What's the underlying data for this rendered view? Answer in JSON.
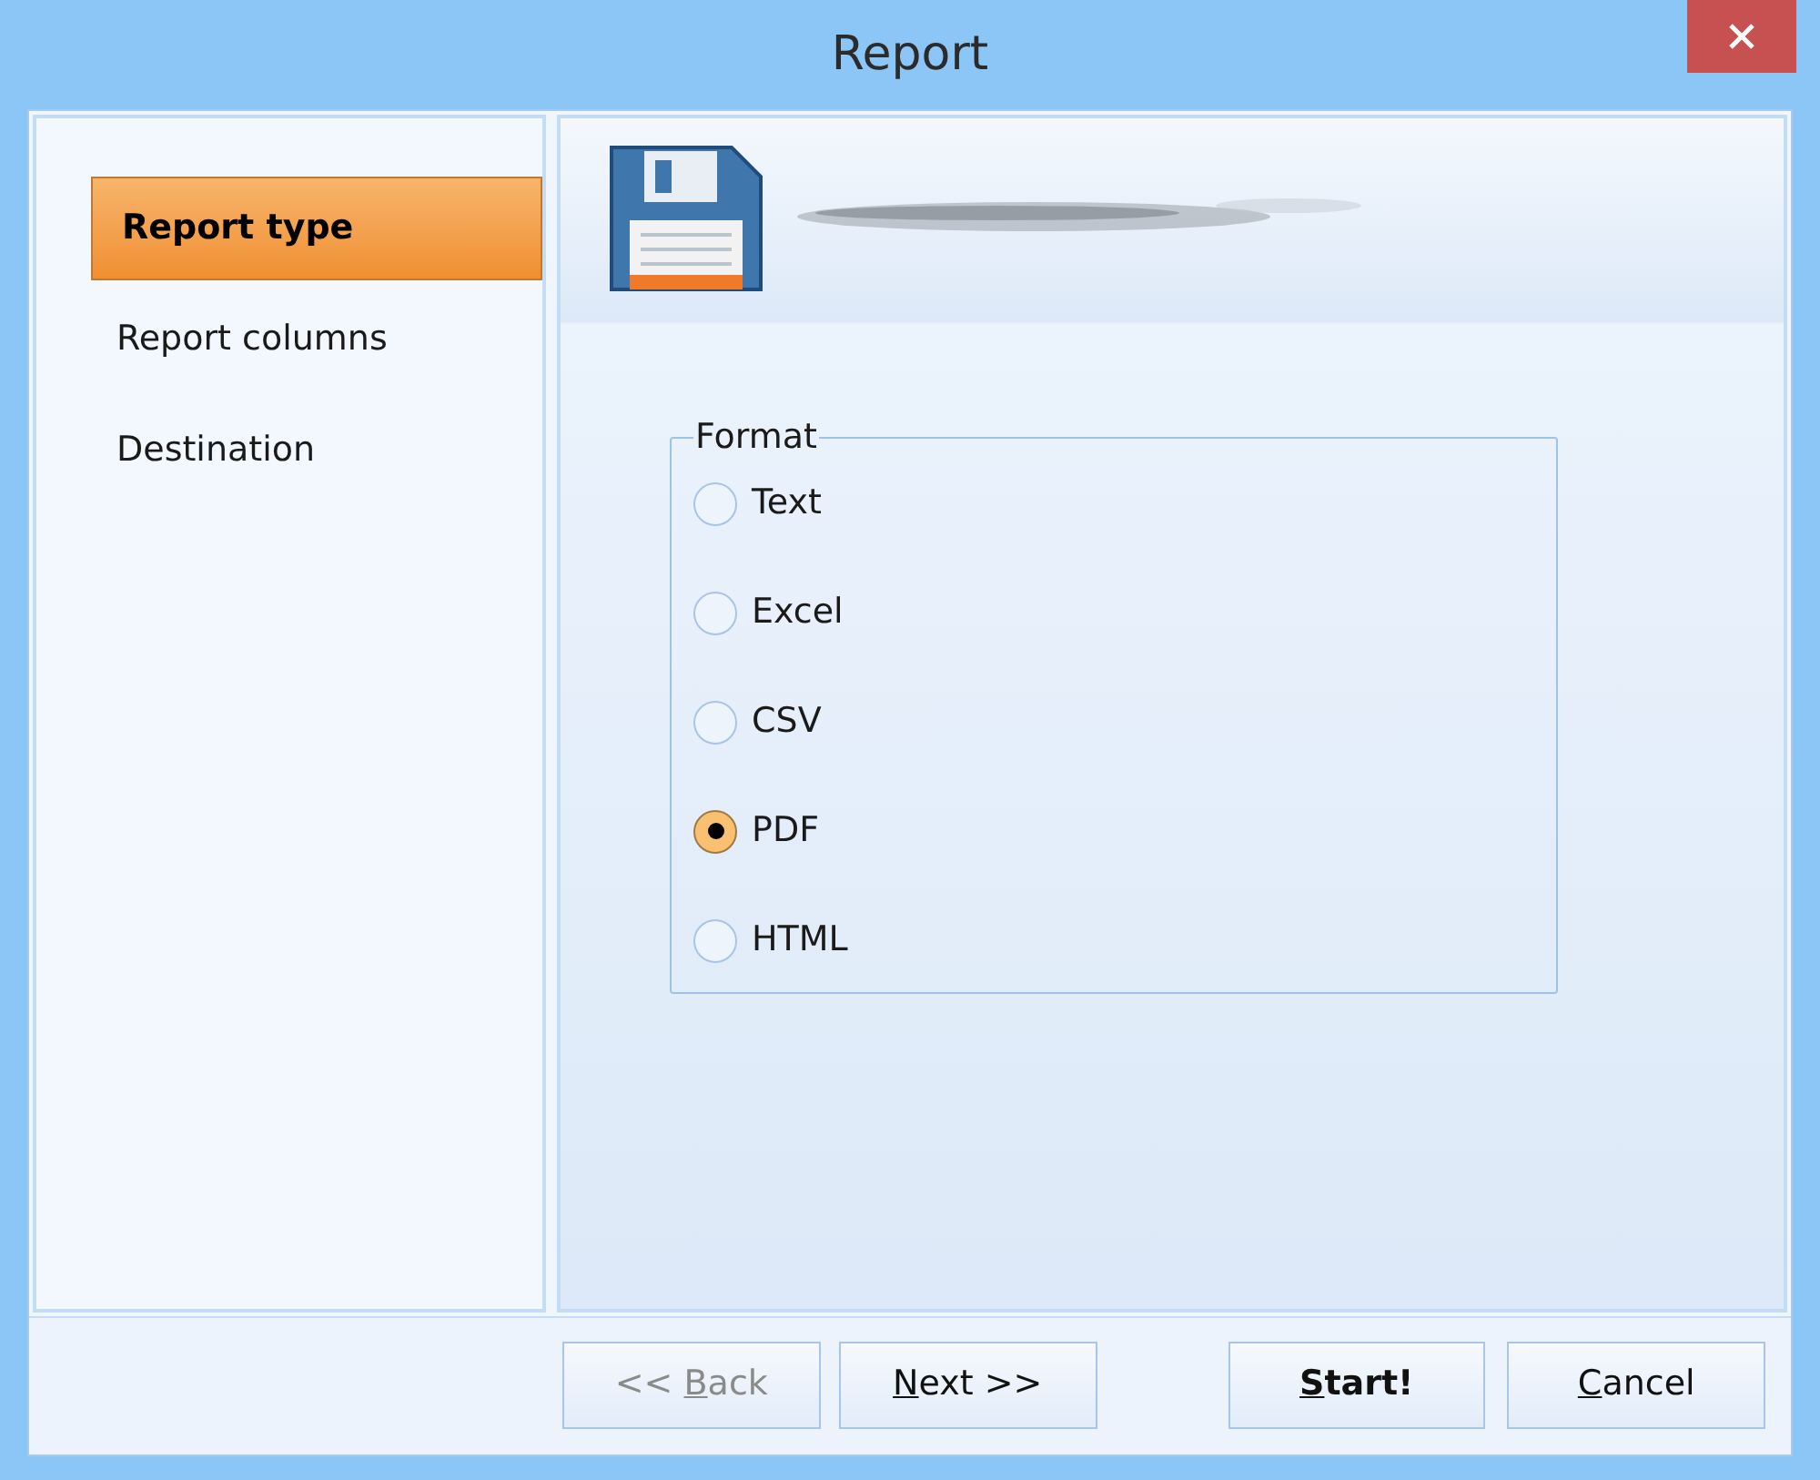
{
  "window": {
    "title": "Report"
  },
  "sidebar": {
    "items": [
      {
        "label": "Report type",
        "selected": true
      },
      {
        "label": "Report columns",
        "selected": false
      },
      {
        "label": "Destination",
        "selected": false
      }
    ]
  },
  "format_group": {
    "title": "Format",
    "options": [
      {
        "label": "Text",
        "selected": false
      },
      {
        "label": "Excel",
        "selected": false
      },
      {
        "label": "CSV",
        "selected": false
      },
      {
        "label": "PDF",
        "selected": true
      },
      {
        "label": "HTML",
        "selected": false
      }
    ]
  },
  "buttons": [
    {
      "before_key": "<< ",
      "access_key": "B",
      "after_key": "ack",
      "disabled": true,
      "bold": false
    },
    {
      "access_key": "N",
      "after_key": "ext >>",
      "disabled": false,
      "bold": false
    },
    {
      "access_key": "S",
      "after_key": "tart!",
      "disabled": false,
      "bold": true
    },
    {
      "access_key": "C",
      "after_key": "ancel",
      "disabled": false,
      "bold": false
    }
  ]
}
